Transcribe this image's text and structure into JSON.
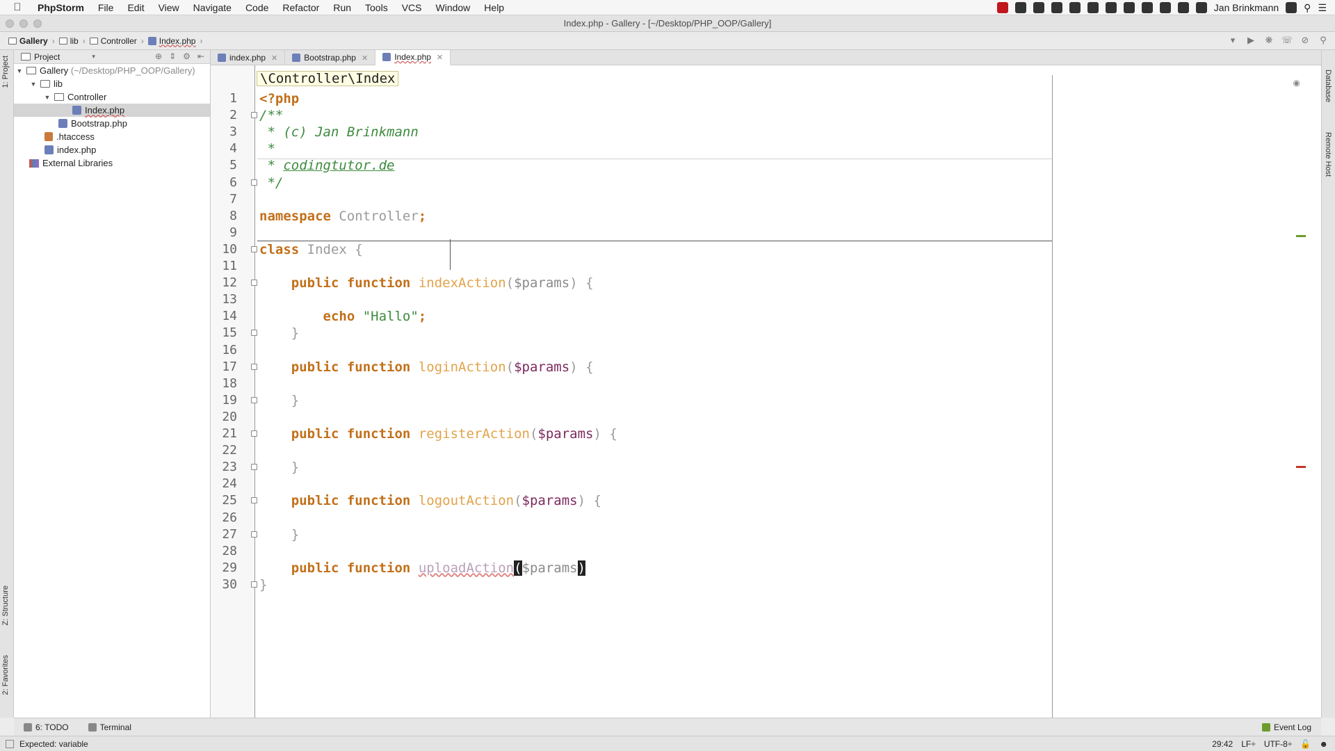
{
  "menubar": {
    "app": "PhpStorm",
    "items": [
      "File",
      "Edit",
      "View",
      "Navigate",
      "Code",
      "Refactor",
      "Run",
      "Tools",
      "VCS",
      "Window",
      "Help"
    ],
    "user": "Jan Brinkmann"
  },
  "window": {
    "title": "Index.php - Gallery - [~/Desktop/PHP_OOP/Gallery]"
  },
  "navbar": {
    "crumbs": [
      "Gallery",
      "lib",
      "Controller",
      "Index.php"
    ]
  },
  "left_strip": {
    "project_tab": "1: Project",
    "structure_tab": "Z: Structure",
    "favorites_tab": "2: Favorites"
  },
  "right_strip": {
    "database_tab": "Database",
    "remote_tab": "Remote Host"
  },
  "project": {
    "header": "Project",
    "root": "Gallery",
    "root_path": "(~/Desktop/PHP_OOP/Gallery)",
    "lib": "lib",
    "controller": "Controller",
    "index_file": "Index.php",
    "bootstrap": "Bootstrap.php",
    "htaccess": ".htaccess",
    "index_lower": "index.php",
    "external": "External Libraries"
  },
  "tabs": [
    {
      "label": "index.php",
      "active": false
    },
    {
      "label": "Bootstrap.php",
      "active": false
    },
    {
      "label": "Index.php",
      "active": true
    }
  ],
  "editor": {
    "breadcrumb": "\\Controller\\Index",
    "line_numbers": [
      "1",
      "2",
      "3",
      "4",
      "5",
      "6",
      "7",
      "8",
      "9",
      "10",
      "11",
      "12",
      "13",
      "14",
      "15",
      "16",
      "17",
      "18",
      "19",
      "20",
      "21",
      "22",
      "23",
      "24",
      "25",
      "26",
      "27",
      "28",
      "29",
      "30"
    ],
    "tokens": {
      "open_tag": "<?php",
      "c_start": "/**",
      "c_author": " * (c) Jan Brinkmann",
      "c_star": " *",
      "c_prefix": " * ",
      "c_link": "codingtutor.de",
      "c_end": " */",
      "kw_namespace": "namespace",
      "ns_name": " Controller",
      "semicolon": ";",
      "kw_class": "class",
      "class_name": " Index {",
      "kw_public_function": "public function",
      "fn_index": "indexAction",
      "fn_login": "loginAction",
      "fn_register": "registerAction",
      "fn_logout": "logoutAction",
      "fn_upload": "uploadAction",
      "open_paren": "(",
      "close_paren": ")",
      "params": "$params",
      "brace_open": " {",
      "brace_close": "}",
      "kw_echo": "echo",
      "str_hallo": " \"Hallo\"",
      "semi": ";"
    }
  },
  "bottom": {
    "todo": "6: TODO",
    "terminal": "Terminal",
    "event_log": "Event Log"
  },
  "status": {
    "message": "Expected: variable",
    "position": "29:42",
    "line_sep": "LF÷",
    "encoding": "UTF-8÷"
  }
}
